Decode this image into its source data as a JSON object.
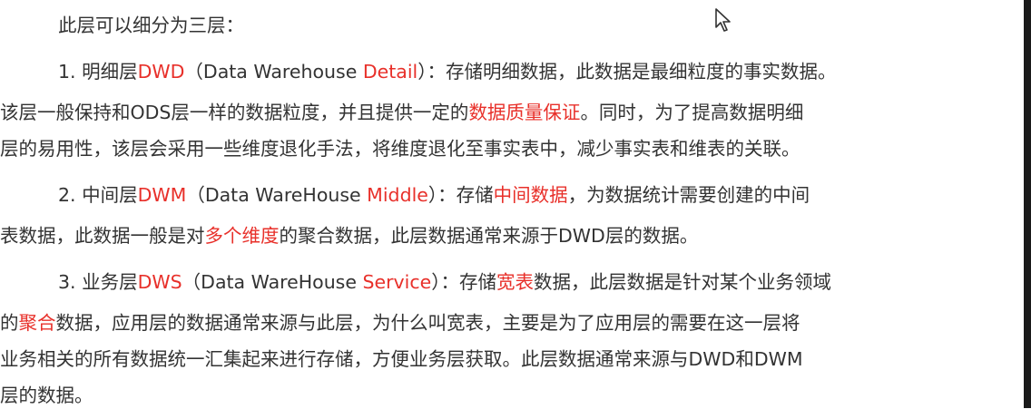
{
  "document": {
    "intro": "此层可以细分为三层：",
    "dwd": {
      "l1a": "1. 明细层",
      "l1b": "DWD",
      "l1c": "（Data Warehouse ",
      "l1d": "Detail",
      "l1e": "）：存储明细数据，此数据是最细粒度的事实数据。",
      "l2a": "该层一般保持和ODS层一样的数据粒度，并且提供一定的",
      "l2b": "数据质量保证",
      "l2c": "。同时，为了提高数据明细",
      "l3": "层的易用性，该层会采用一些维度退化手法，将维度退化至事实表中，减少事实表和维表的关联。"
    },
    "dwm": {
      "l1a": "2. 中间层",
      "l1b": "DWM",
      "l1c": "（Data WareHouse ",
      "l1d": "Middle",
      "l1e": "）：存储",
      "l1f": "中间数据",
      "l1g": "，为数据统计需要创建的中间",
      "l2a": "表数据，此数据一般是对",
      "l2b": "多个维度",
      "l2c": "的聚合数据，此层数据通常来源于DWD层的数据。"
    },
    "dws": {
      "l1a": "3. 业务层",
      "l1b": "DWS",
      "l1c": "（Data WareHouse ",
      "l1d": "Service",
      "l1e": "）：存储",
      "l1f": "宽表",
      "l1g": "数据，此层数据是针对某个业务领域",
      "l2a": "的",
      "l2b": "聚合",
      "l2c": "数据，应用层的数据通常来源与此层，为什么叫宽表，主要是为了应用层的需要在这一层将",
      "l3": "业务相关的所有数据统一汇集起来进行存储，方便业务层获取。此层数据通常来源与DWD和DWM",
      "l4": "层的数据。"
    }
  },
  "colors": {
    "text": "#333333",
    "highlight": "#e8302a"
  },
  "icons": {
    "cursor": "mouse-pointer-icon"
  }
}
